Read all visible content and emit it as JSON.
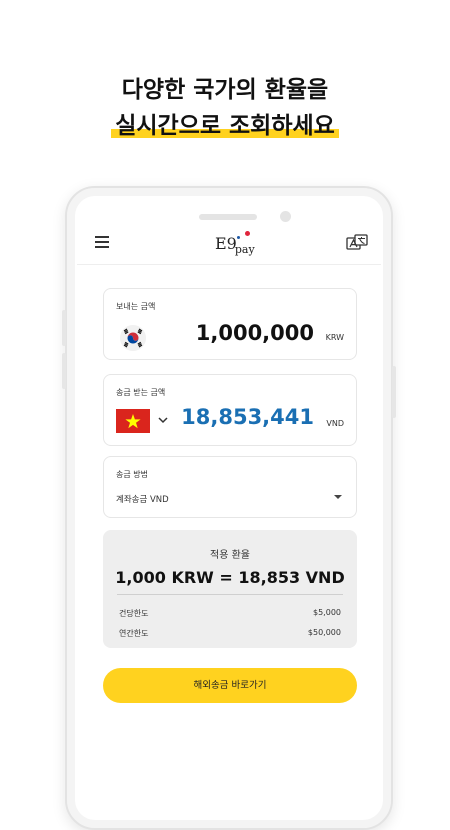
{
  "headline": {
    "line1": "다양한 국가의 환율을",
    "line2": "실시간으로 조회하세요"
  },
  "app": {
    "logo_main": "E9",
    "logo_sub": "pay",
    "icons": {
      "menu": "menu-icon",
      "language": "translate-icon",
      "chevron": "chevron-down-icon"
    }
  },
  "send": {
    "label": "보내는 금액",
    "amount": "1,000,000",
    "currency": "KRW",
    "flag": "korea-flag"
  },
  "receive": {
    "label": "송금 받는 금액",
    "amount": "18,853,441",
    "currency": "VND",
    "flag": "vietnam-flag"
  },
  "method": {
    "label": "송금 방법",
    "value": "계좌송금 VND"
  },
  "rate": {
    "title": "적용 환율",
    "value": "1,000 KRW = 18,853 VND",
    "per_transaction_label": "건당한도",
    "per_transaction_value": "$5,000",
    "annual_label": "연간한도",
    "annual_value": "$50,000"
  },
  "cta": {
    "label": "해외송금 바로가기"
  },
  "colors": {
    "accent": "#FFD21F",
    "amount_blue": "#1a6fb3",
    "rate_bg": "#eeeeee"
  }
}
